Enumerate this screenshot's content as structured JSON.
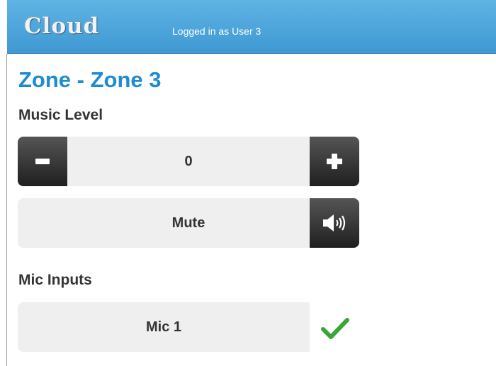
{
  "header": {
    "logo": "Cloud",
    "login_status": "Logged in as User 3"
  },
  "zone": {
    "title": "Zone - Zone 3"
  },
  "music": {
    "label": "Music Level",
    "level_value": "0",
    "decrease_icon": "minus-icon",
    "increase_icon": "plus-icon",
    "mute_label": "Mute",
    "mute_icon": "speaker-icon"
  },
  "mic_inputs": {
    "label": "Mic Inputs",
    "items": [
      {
        "label": "Mic 1",
        "enabled": true,
        "status_icon": "checkmark-icon"
      }
    ]
  },
  "colors": {
    "header_blue": "#4aa6dc",
    "title_blue": "#1c8bd3",
    "check_green": "#3aa63a",
    "button_dark": "#2b2b2b"
  }
}
